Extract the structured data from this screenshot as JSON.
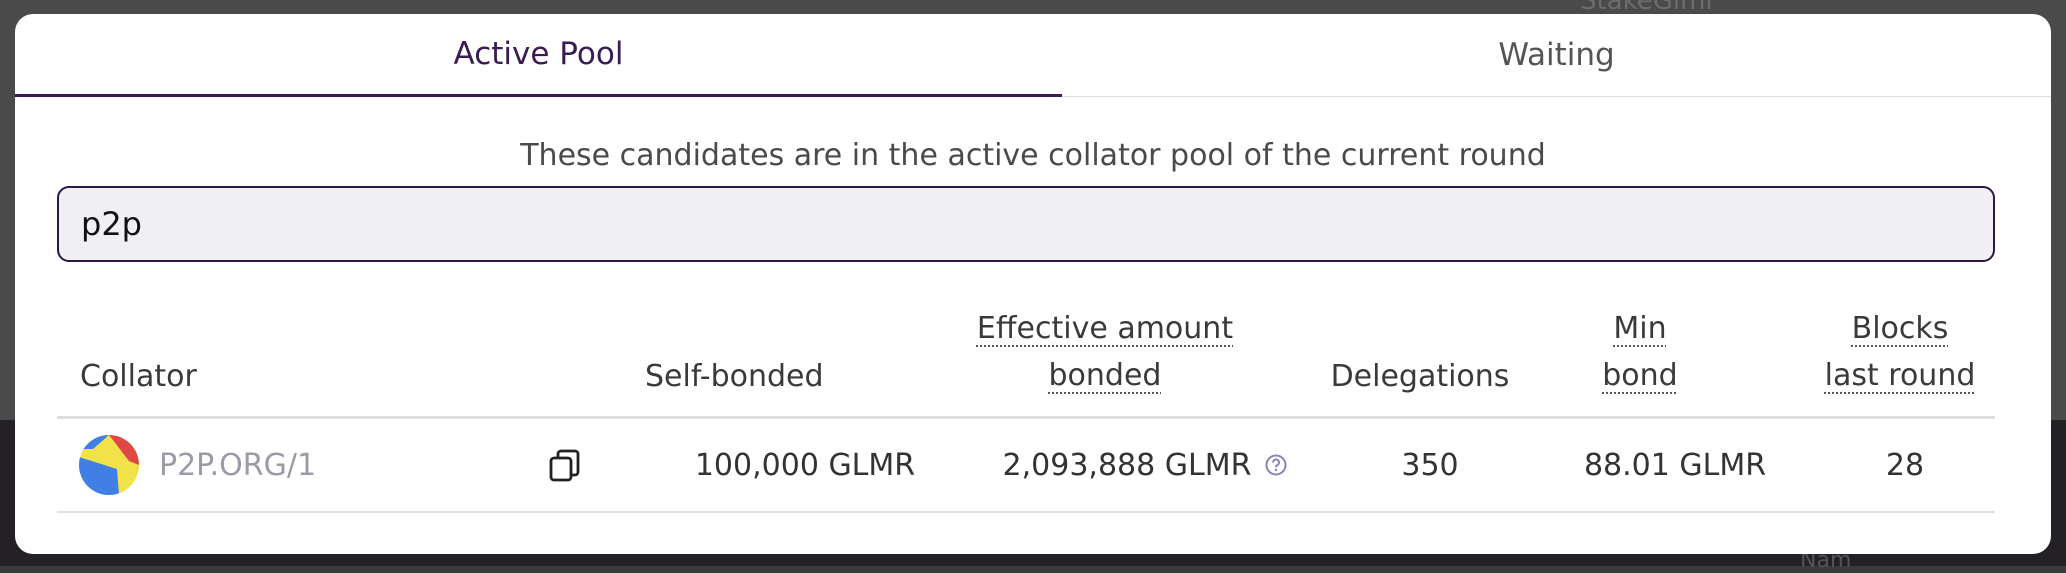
{
  "background": {
    "ghost_top": "StakeGlmr",
    "ghost_bottom": "Nam"
  },
  "tabs": [
    {
      "label": "Active Pool",
      "active": true
    },
    {
      "label": "Waiting",
      "active": false
    }
  ],
  "description": "These candidates are in the active collator pool of the current round",
  "search": {
    "value": "p2p"
  },
  "table": {
    "headers": {
      "collator": "Collator",
      "self_bonded": "Self-bonded",
      "effective_line1": "Effective amount",
      "effective_line2": "bonded",
      "delegations": "Delegations",
      "min_bond_line1": "Min",
      "min_bond_line2": "bond",
      "blocks_line1": "Blocks",
      "blocks_line2": "last round"
    },
    "rows": [
      {
        "collator": "P2P.ORG/1",
        "self_bonded": "100,000 GLMR",
        "effective_bonded": "2,093,888 GLMR",
        "delegations": "350",
        "min_bond": "88.01 GLMR",
        "blocks_last_round": "28"
      }
    ]
  },
  "colors": {
    "accent": "#3a1b55",
    "search_bg": "#f0eff4",
    "collator_name": "#9b9aa6"
  },
  "icons": {
    "avatar": "identicon-avatar",
    "copy": "copy-icon",
    "info": "question-circle-icon"
  }
}
